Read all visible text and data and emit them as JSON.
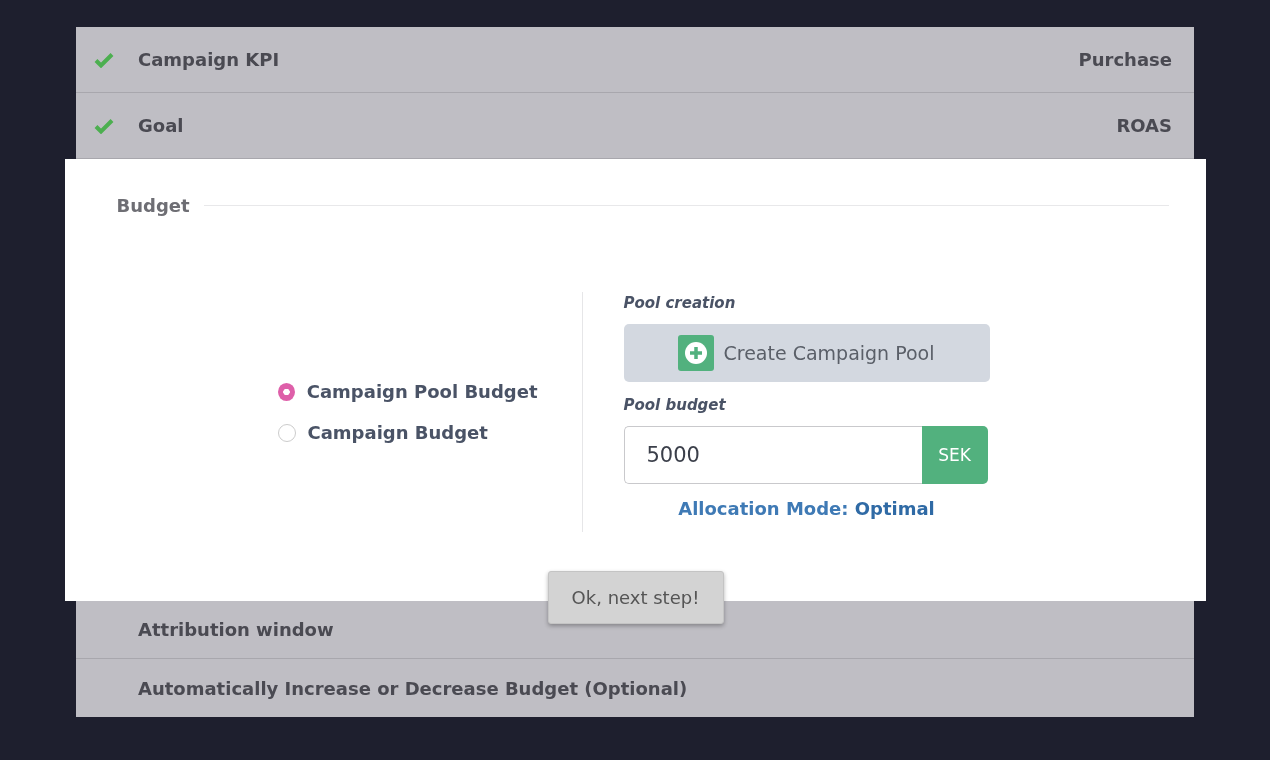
{
  "steps_above": [
    {
      "label": "Campaign KPI",
      "value": "Purchase",
      "completed": true
    },
    {
      "label": "Goal",
      "value": "ROAS",
      "completed": true
    }
  ],
  "budget_dialog": {
    "title": "Budget",
    "options": [
      {
        "label": "Campaign Pool Budget",
        "selected": true
      },
      {
        "label": "Campaign Budget",
        "selected": false
      }
    ],
    "pool_creation_label": "Pool creation",
    "create_pool_button": "Create Campaign Pool",
    "pool_budget_label": "Pool budget",
    "pool_budget_value": "5000",
    "currency": "SEK",
    "allocation_mode": {
      "label": "Allocation Mode:",
      "value": "Optimal"
    },
    "next_button": "Ok, next step!"
  },
  "steps_below": [
    {
      "label": "Attribution window",
      "completed": false
    },
    {
      "label": "Automatically Increase or Decrease Budget (Optional)",
      "completed": false
    }
  ]
}
